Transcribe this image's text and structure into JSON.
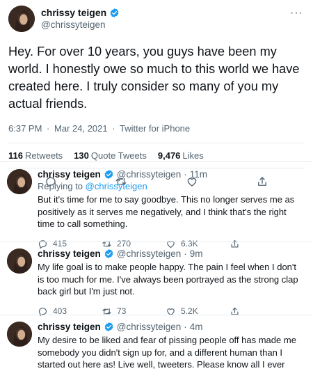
{
  "main_tweet": {
    "author": {
      "name": "chrissy teigen",
      "handle": "@chrissyteigen",
      "verified": true
    },
    "more_icon": "more-icon",
    "text": "Hey. For over 10 years, you guys have been my world. I honestly owe so much to this world we have created here. I truly consider so many of you my actual friends.",
    "time": "6:37 PM",
    "dot": "·",
    "date": "Mar 24, 2021",
    "client": "Twitter for iPhone",
    "stats": {
      "retweets": "116",
      "retweets_label": "Retweets",
      "quote_tweets": "130",
      "quote_tweets_label": "Quote Tweets",
      "likes": "9,476",
      "likes_label": "Likes"
    },
    "actions": [
      "reply-icon",
      "retweet-icon",
      "like-icon",
      "share-icon"
    ]
  },
  "replies": [
    {
      "name": "chrissy teigen",
      "handle": "@chrissyteigen",
      "dot": "·",
      "time": "11m",
      "replying_prefix": "Replying to",
      "replying_to": "@chrissyteigen",
      "text": "But it's time for me to say goodbye. This no longer serves me as positively as it serves me negatively, and I think that's the right time to call something.",
      "replies": "415",
      "retweets": "270",
      "likes": "6.3K"
    },
    {
      "name": "chrissy teigen",
      "handle": "@chrissyteigen",
      "dot": "·",
      "time": "9m",
      "text": "My life goal is to make people happy. The pain I feel when I don't is too much for me. I've always been portrayed as the strong clap back girl but I'm just not.",
      "replies": "403",
      "retweets": "73",
      "likes": "5.2K"
    },
    {
      "name": "chrissy teigen",
      "handle": "@chrissyteigen",
      "dot": "·",
      "time": "4m",
      "text": "My desire to be liked and fear of pissing people off has made me somebody you didn't sign up for, and a different human than I started out here as! Live well, tweeters. Please know all I ever cared about was you!!!"
    }
  ],
  "colors": {
    "verified": "#1d9bf0",
    "link": "#1d9bf0",
    "muted": "#536471"
  }
}
